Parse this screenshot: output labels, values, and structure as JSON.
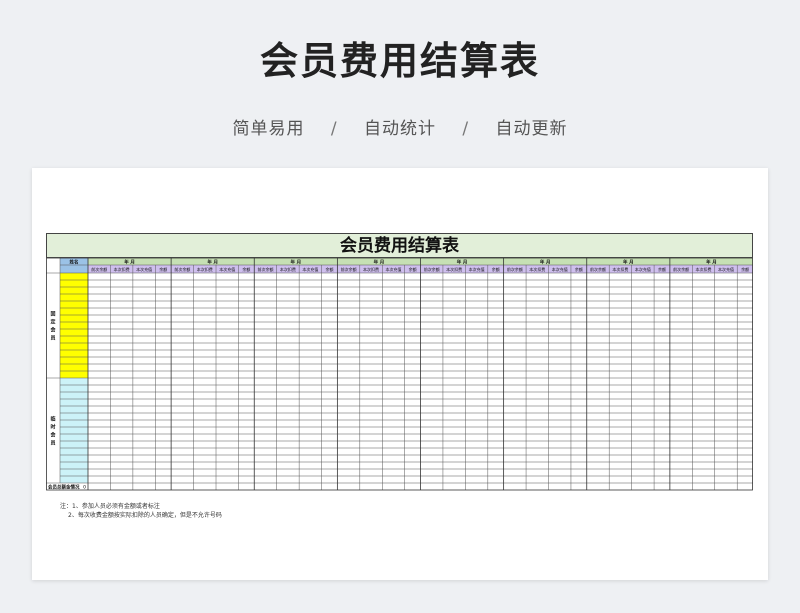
{
  "page": {
    "title": "会员费用结算表",
    "features": [
      "简单易用",
      "自动统计",
      "自动更新"
    ],
    "separator": "/"
  },
  "sheet": {
    "title": "会员费用结算表",
    "name_header": "姓名",
    "month_header": "年   月",
    "sub_headers": [
      "前次余额",
      "本次扣费",
      "本次充值",
      "余额"
    ],
    "period_count": 8,
    "groups": [
      {
        "label": "固定会员",
        "rows": 15,
        "color": "#ffff00"
      },
      {
        "label": "临时会员",
        "rows": 15,
        "color": "#ccf2f8"
      }
    ],
    "total_label": "会员总额金情况",
    "total_value": "0",
    "colors": {
      "title_bg": "#e2efd9",
      "header_bg": "#c6e0b4",
      "subheader_bg": "#cfbfee",
      "name_header_bg": "#9bc2e6"
    }
  },
  "notes": [
    "注：1、参加人员必须有金额或者标注",
    "2、每次收费金额按实际扣除的人员确定，但是不允许号码"
  ]
}
